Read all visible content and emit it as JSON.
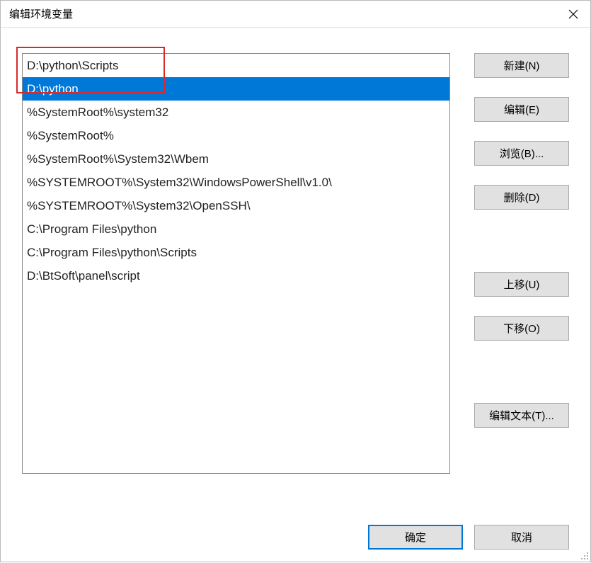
{
  "window": {
    "title": "编辑环境变量"
  },
  "list": {
    "items": [
      "D:\\python\\Scripts",
      "D:\\python",
      "%SystemRoot%\\system32",
      "%SystemRoot%",
      "%SystemRoot%\\System32\\Wbem",
      "%SYSTEMROOT%\\System32\\WindowsPowerShell\\v1.0\\",
      "%SYSTEMROOT%\\System32\\OpenSSH\\",
      "C:\\Program Files\\python",
      "C:\\Program Files\\python\\Scripts",
      "D:\\BtSoft\\panel\\script"
    ],
    "selected_index": 1
  },
  "buttons": {
    "new": "新建(N)",
    "edit": "编辑(E)",
    "browse": "浏览(B)...",
    "delete": "删除(D)",
    "move_up": "上移(U)",
    "move_down": "下移(O)",
    "edit_text": "编辑文本(T)...",
    "ok": "确定",
    "cancel": "取消"
  }
}
